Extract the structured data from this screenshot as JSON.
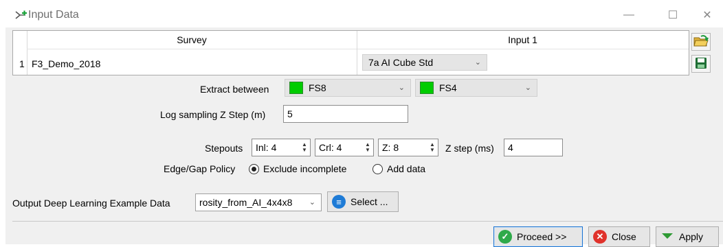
{
  "window": {
    "title": "Input Data",
    "controls": {
      "minimize": "—",
      "maximize": "☐",
      "close": "✕"
    }
  },
  "table": {
    "columns": [
      "Survey",
      "Input 1"
    ],
    "rows": [
      {
        "num": "1",
        "survey": "F3_Demo_2018",
        "input": "7a AI Cube Std"
      }
    ]
  },
  "extract": {
    "label": "Extract between",
    "from": "FS8",
    "to": "FS4",
    "swatch_color": "#00cc00"
  },
  "log_sampling": {
    "label": "Log sampling Z Step (m)",
    "value": "5"
  },
  "stepouts": {
    "label": "Stepouts",
    "inl": "Inl: 4",
    "crl": "Crl: 4",
    "z": "Z: 8",
    "zstep_label": "Z step (ms)",
    "zstep_value": "4"
  },
  "policy": {
    "label": "Edge/Gap Policy",
    "options": [
      "Exclude incomplete",
      "Add data"
    ],
    "selected": "Exclude incomplete"
  },
  "output": {
    "label": "Output Deep Learning Example Data",
    "value": "rosity_from_AI_4x4x8",
    "select_label": "Select ..."
  },
  "buttons": {
    "proceed": "Proceed >>",
    "close": "Close",
    "apply": "Apply"
  },
  "icons": {
    "title": "tree-arrow-icon",
    "open": "folder-open-icon",
    "save": "floppy-save-icon",
    "select": "list-icon",
    "proceed": "check-circle-icon",
    "close": "x-circle-icon",
    "apply": "green-triangle-icon"
  }
}
